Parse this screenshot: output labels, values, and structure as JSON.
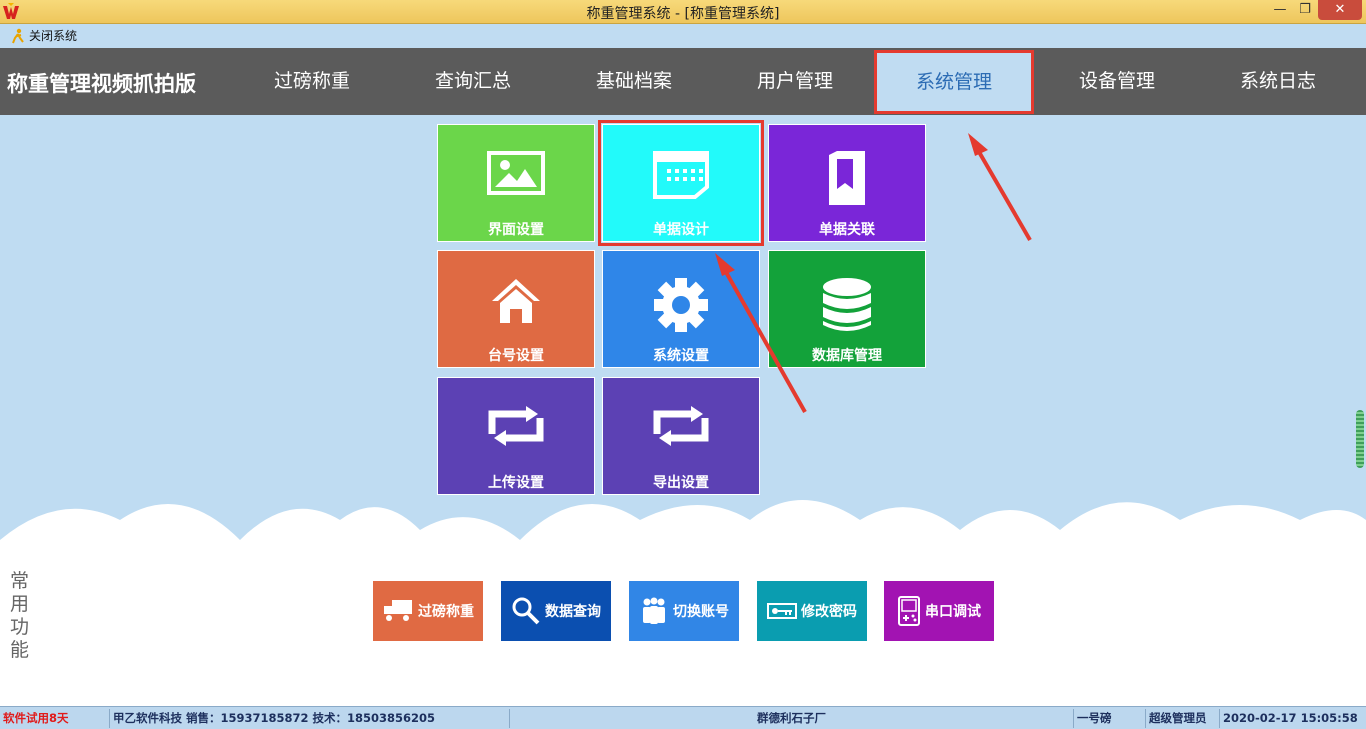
{
  "window": {
    "title": "称重管理系统 - [称重管理系统]",
    "app_icon": "w-logo-icon",
    "minimize": "—",
    "maximize": "❐",
    "close": "✕"
  },
  "toolbar": {
    "close_system": "关闭系统"
  },
  "nav": {
    "brand": "称重管理视频抓拍版",
    "items": [
      {
        "label": "过磅称重"
      },
      {
        "label": "查询汇总"
      },
      {
        "label": "基础档案"
      },
      {
        "label": "用户管理"
      },
      {
        "label": "系统管理",
        "active": true
      },
      {
        "label": "设备管理"
      },
      {
        "label": "系统日志"
      }
    ]
  },
  "tiles": [
    {
      "label": "界面设置",
      "icon": "image-icon",
      "color": "#6bd64a"
    },
    {
      "label": "单据设计",
      "icon": "document-icon",
      "color": "#22fafa",
      "highlighted": true
    },
    {
      "label": "单据关联",
      "icon": "bookmark-icon",
      "color": "#7a26d8"
    },
    {
      "label": "台号设置",
      "icon": "home-icon",
      "color": "#df6a43"
    },
    {
      "label": "系统设置",
      "icon": "gear-icon",
      "color": "#2f86e8"
    },
    {
      "label": "数据库管理",
      "icon": "database-icon",
      "color": "#13a23a"
    },
    {
      "label": "上传设置",
      "icon": "repeat-icon",
      "color": "#5c41b4"
    },
    {
      "label": "导出设置",
      "icon": "repeat-icon",
      "color": "#5c41b4"
    }
  ],
  "common": {
    "label": "常用功能",
    "buttons": [
      {
        "label": "过磅称重",
        "icon": "truck-icon",
        "color": "#e06a43"
      },
      {
        "label": "数据查询",
        "icon": "search-icon",
        "color": "#0b4fb0"
      },
      {
        "label": "切换账号",
        "icon": "users-icon",
        "color": "#3186e6"
      },
      {
        "label": "修改密码",
        "icon": "key-icon",
        "color": "#0a9db0"
      },
      {
        "label": "串口调试",
        "icon": "gamepad-icon",
        "color": "#a213b2"
      }
    ]
  },
  "status": {
    "trial": "软件试用8天",
    "company": "甲乙软件科技  销售：15937185872  技术：18503856205",
    "factory": "群德利石子厂",
    "scale": "一号磅",
    "role": "超级管理员",
    "datetime": "2020-02-17  15:05:58"
  }
}
